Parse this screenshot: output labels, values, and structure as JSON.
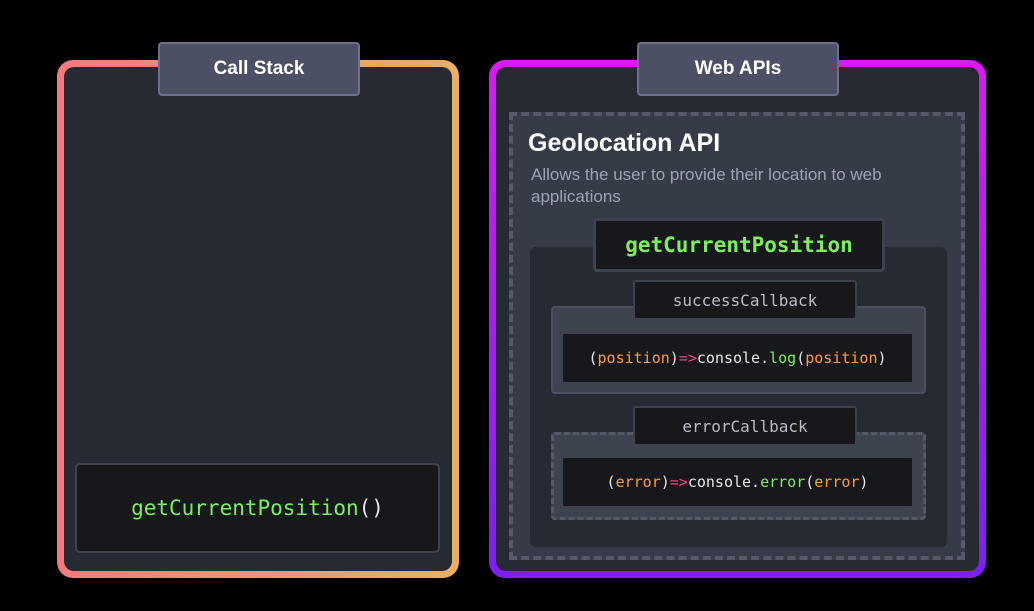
{
  "call_stack": {
    "title": "Call Stack",
    "frame": {
      "function": "getCurrentPosition",
      "parens": "()"
    }
  },
  "web_apis": {
    "title": "Web APIs",
    "api": {
      "name": "Geolocation API",
      "description": "Allows the user to provide their location to web applications",
      "method": "getCurrentPosition",
      "success": {
        "label": "successCallback",
        "code": {
          "open": "(",
          "param": "position",
          "close": ")",
          "arrow": "=>",
          "obj": "console",
          "dot": ".",
          "method": "log",
          "call_open": "(",
          "arg": "position",
          "call_close": ")"
        }
      },
      "error": {
        "label": "errorCallback",
        "code": {
          "open": "(",
          "param": "error",
          "close": ")",
          "arrow": "=>",
          "obj": "console",
          "dot": ".",
          "method": "error",
          "call_open": "(",
          "arg": "error",
          "call_close": ")"
        }
      }
    }
  },
  "colors": {
    "background": "#000000",
    "call_stack_border_start": "#f07a7e",
    "call_stack_border_end": "#e9b062",
    "web_apis_border_start": "#d81bf0",
    "web_apis_border_end": "#7d1ff0",
    "function_green": "#7cf05c",
    "param_orange": "#ff9b3d",
    "arrow_pink": "#ff3d8b"
  }
}
